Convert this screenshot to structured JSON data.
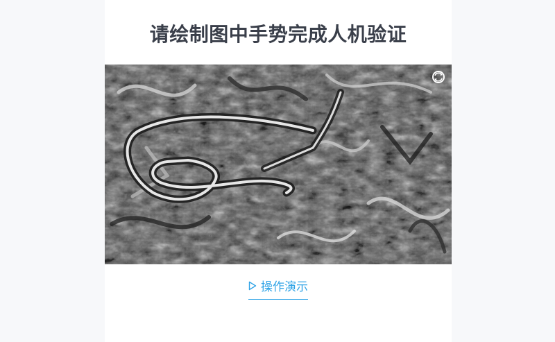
{
  "captcha": {
    "title": "请绘制图中手势完成人机验证",
    "refresh_icon": "refresh-icon",
    "demo_label": "操作演示",
    "demo_icon": "play-outline-icon",
    "accent_color": "#2fa3e6",
    "title_color": "#3a3f4a"
  }
}
